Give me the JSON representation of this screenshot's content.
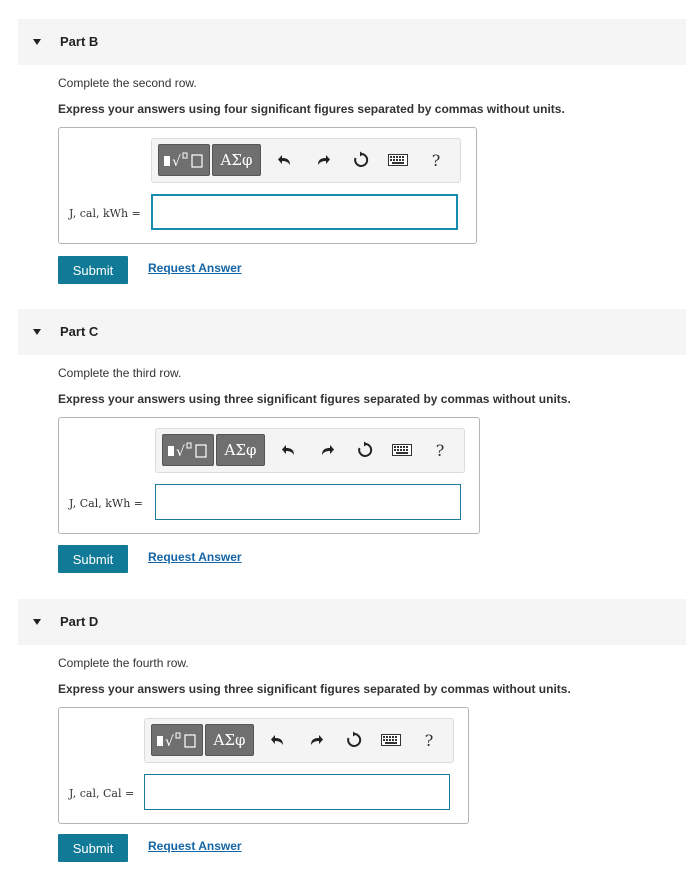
{
  "parts": [
    {
      "title": "Part B",
      "prompt": "Complete the second row.",
      "instruction": "Express your answers using four significant figures separated by commas without units.",
      "label": "J, cal, kWh =",
      "input_value": "",
      "submit": "Submit",
      "request": "Request Answer"
    },
    {
      "title": "Part C",
      "prompt": "Complete the third row.",
      "instruction": "Express your answers using three significant figures separated by commas without units.",
      "label": "J, Cal, kWh =",
      "input_value": "",
      "submit": "Submit",
      "request": "Request Answer"
    },
    {
      "title": "Part D",
      "prompt": "Complete the fourth row.",
      "instruction": "Express your answers using three significant figures separated by commas without units.",
      "label": "J, cal, Cal =",
      "input_value": "",
      "submit": "Submit",
      "request": "Request Answer"
    }
  ],
  "toolbar": {
    "greek_label": "ΑΣφ",
    "help_label": "?",
    "icons": [
      "templates-icon",
      "undo-icon",
      "redo-icon",
      "reset-icon",
      "keyboard-icon",
      "help-icon"
    ]
  },
  "colors": {
    "accent": "#117a96",
    "link": "#1565a6",
    "header_bg": "#f5f5f5"
  }
}
